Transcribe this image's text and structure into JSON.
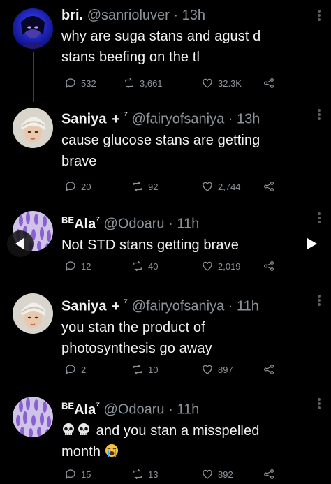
{
  "tweets": [
    {
      "name": "bri.",
      "handle": "@sanrioluver",
      "time": "13h",
      "text_lines": [
        "why are suga stans and agust d",
        "stans beefing on the tl"
      ],
      "replies": "532",
      "retweets": "3,661",
      "likes": "32.3K"
    },
    {
      "name": "Saniya",
      "plus": "+",
      "sup": "⁷",
      "handle": "@fairyofsaniya",
      "time": "13h",
      "text_lines": [
        "cause glucose stans are getting",
        "brave"
      ],
      "replies": "20",
      "retweets": "92",
      "likes": "2,744"
    },
    {
      "name_prefix": "BE",
      "name": "Ala",
      "sup": "⁷",
      "handle": "@Odoaru",
      "time": "11h",
      "text_lines": [
        "Not STD stans getting brave"
      ],
      "replies": "12",
      "retweets": "40",
      "likes": "2,019"
    },
    {
      "name": "Saniya",
      "plus": "+",
      "sup": "⁷",
      "handle": "@fairyofsaniya",
      "time": "11h",
      "text_lines": [
        "you stan the product of",
        "photosynthesis go away"
      ],
      "replies": "2",
      "retweets": "10",
      "likes": "897"
    },
    {
      "name_prefix": "BE",
      "name": "Ala",
      "sup": "⁷",
      "handle": "@Odoaru",
      "time": "11h",
      "text_lines": [
        "and you stan a misspelled",
        "month"
      ],
      "emoji_prefix": [
        "skull-emoji",
        "skull-emoji"
      ],
      "emoji_suffix": "loudly-crying-emoji",
      "replies": "15",
      "retweets": "13",
      "likes": "892"
    }
  ],
  "separator": "·",
  "colors": {
    "background": "#000000",
    "text": "#f2f2f2",
    "muted": "#8b949a",
    "thread": "#3d4147"
  }
}
